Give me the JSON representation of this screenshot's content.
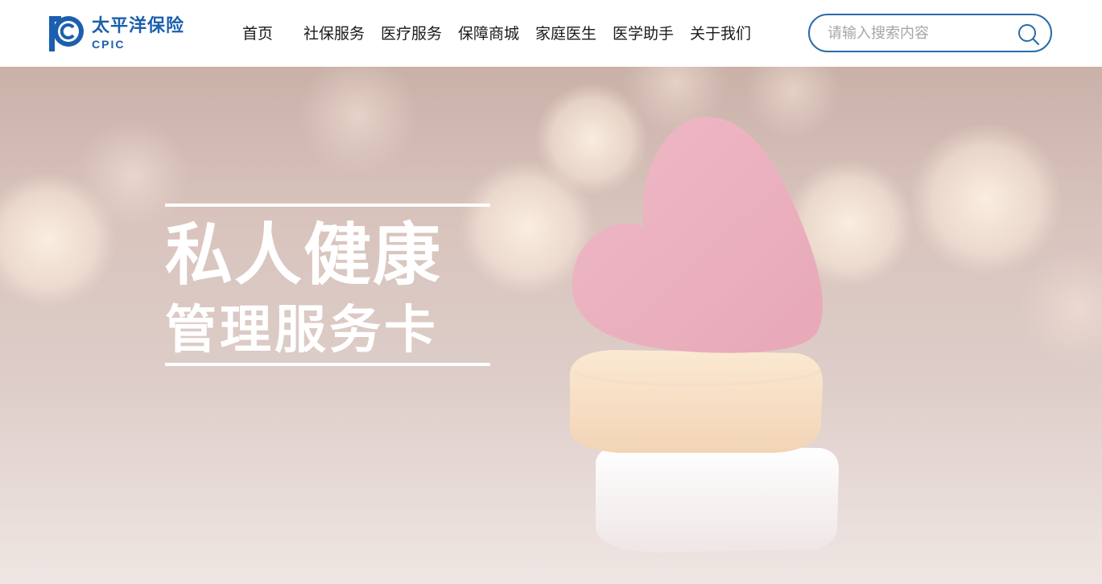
{
  "brand": {
    "name_cn": "太平洋保险",
    "name_en": "CPIC",
    "color": "#1b5fae"
  },
  "nav": {
    "items": [
      {
        "label": "首页"
      },
      {
        "label": "社保服务"
      },
      {
        "label": "医疗服务"
      },
      {
        "label": "保障商城"
      },
      {
        "label": "家庭医生"
      },
      {
        "label": "医学助手"
      },
      {
        "label": "关于我们"
      }
    ]
  },
  "search": {
    "placeholder": "请输入搜索内容",
    "value": "",
    "icon": "search-icon",
    "border_color": "#2c6aa8"
  },
  "hero": {
    "title_line1": "私人健康",
    "title_line2": "管理服务卡",
    "image": "heart-candies"
  }
}
